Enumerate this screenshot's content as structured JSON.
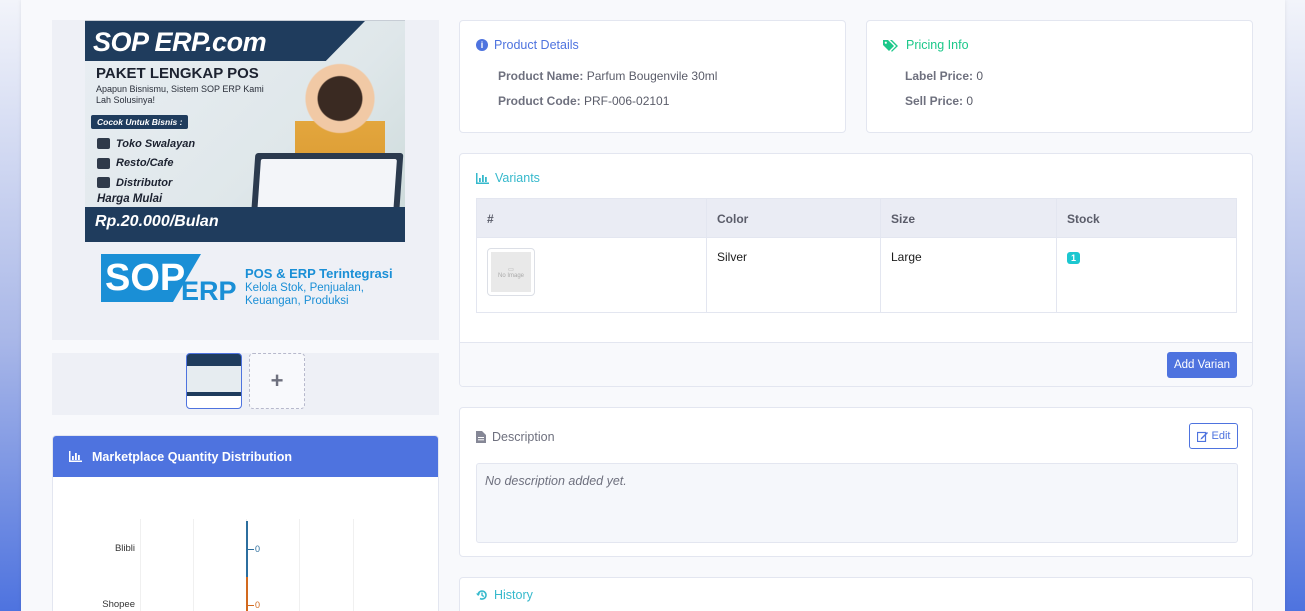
{
  "banner": {
    "headline": "SOP ERP.com",
    "subtitle": "PAKET LENGKAP POS",
    "tagline": "Apapun Bisnismu, Sistem SOP ERP Kami Lah Solusinya!",
    "pill": "Cocok Untuk Bisnis :",
    "items": [
      "Toko Swalayan",
      "Resto/Cafe",
      "Distributor"
    ],
    "price_label": "Harga Mulai",
    "price": "Rp.20.000/Bulan"
  },
  "brand": {
    "sop": "SOP",
    "erp": "ERP",
    "line1": "POS & ERP Terintegrasi",
    "line2": "Kelola Stok, Penjualan, Keuangan, Produksi"
  },
  "thumbs": {
    "add_label": "+"
  },
  "marketplace": {
    "title": "Marketplace Quantity Distribution",
    "chart_data": {
      "type": "bar",
      "categories": [
        "Blibli",
        "Shopee"
      ],
      "values": [
        0,
        0
      ],
      "colors": [
        "#2c6e9e",
        "#d2691e"
      ]
    }
  },
  "product_details": {
    "title": "Product Details",
    "name_label": "Product Name:",
    "name_value": "Parfum Bougenvile 30ml",
    "code_label": "Product Code:",
    "code_value": "PRF-006-02101"
  },
  "pricing": {
    "title": "Pricing Info",
    "label_price_label": "Label Price:",
    "label_price_value": "0",
    "sell_price_label": "Sell Price:",
    "sell_price_value": "0"
  },
  "variants": {
    "title": "Variants",
    "columns": [
      "#",
      "Color",
      "Size",
      "Stock"
    ],
    "rows": [
      {
        "image": "No Image",
        "color": "Silver",
        "size": "Large",
        "stock": "1"
      }
    ],
    "add_button": "Add Varian"
  },
  "description": {
    "title": "Description",
    "edit_button": "Edit",
    "empty_text": "No description added yet."
  },
  "history": {
    "title": "History"
  },
  "colors": {
    "primary": "#4e73df",
    "success": "#1cc88a",
    "info": "#36b9cc",
    "badge": "#1cc7d0"
  }
}
